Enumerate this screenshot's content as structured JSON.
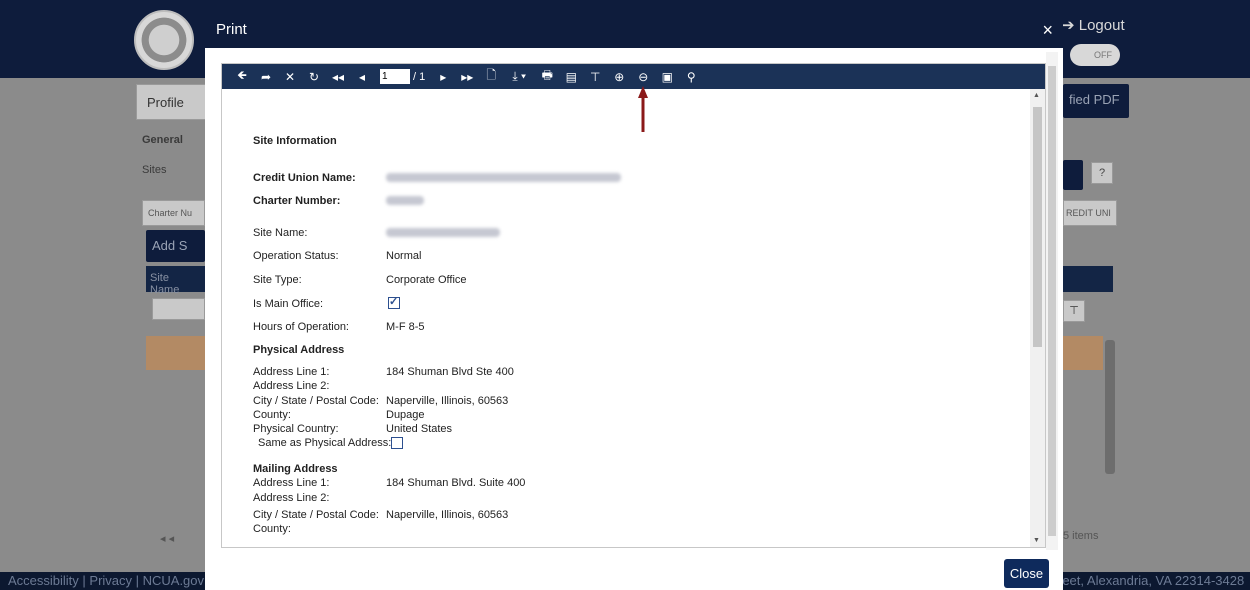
{
  "background": {
    "logout": "➔ Logout",
    "toggle": "OFF",
    "tab_profile": "Profile",
    "subtab_general": "General",
    "label_sites": "Sites",
    "filter_charter": "Charter Nu",
    "add_button": "Add S",
    "col_site_name": "Site Name",
    "verified_pdf": "fied PDF",
    "help": "?",
    "credit_uni": "REDIT UNI",
    "items": "5 items",
    "footer_left": "Accessibility | Privacy | NCUA.gov",
    "footer_right": "reet, Alexandria, VA 22314-3428"
  },
  "modal": {
    "title": "Print",
    "close_x": "×",
    "close_button": "Close"
  },
  "toolbar": {
    "page_current": "1",
    "page_total": "/ 1",
    "icons": [
      "undo-icon",
      "redo-icon",
      "stop-icon",
      "refresh-icon",
      "first-page-icon",
      "previous-page-icon",
      "next-page-icon",
      "last-page-icon",
      "page-setup-icon",
      "export-icon",
      "print-icon",
      "print-layout-icon",
      "parameters-icon",
      "zoom-in-icon",
      "zoom-out-icon",
      "full-screen-icon",
      "search-icon"
    ]
  },
  "report": {
    "section_title": "Site Information",
    "credit_union_label": "Credit Union Name:",
    "charter_number_label": "Charter Number:",
    "site_name_label": "Site Name:",
    "operation_status_label": "Operation Status:",
    "operation_status": "Normal",
    "site_type_label": "Site Type:",
    "site_type": "Corporate Office",
    "main_office_label": "Is Main Office:",
    "hours_label": "Hours of Operation:",
    "hours": "M-F 8-5",
    "physical_heading": "Physical Address",
    "phys_line1_label": "Address Line 1:",
    "phys_line1": "184 Shuman Blvd Ste 400",
    "phys_line2_label": "Address Line 2:",
    "phys_city_label": "City / State / Postal Code:",
    "phys_city": "Naperville, Illinois, 60563",
    "phys_county_label": "County:",
    "phys_county": "Dupage",
    "phys_country_label": "Physical Country:",
    "phys_country": "United States",
    "same_as_label": "Same as Physical Address:",
    "mailing_heading": "Mailing Address",
    "mail_line1_label": "Address Line 1:",
    "mail_line1": "184 Shuman Blvd. Suite 400",
    "mail_line2_label": "Address Line 2:",
    "mail_city_label": "City / State / Postal Code:",
    "mail_city": "Naperville, Illinois, 60563",
    "mail_county_label": "County:"
  },
  "colors": {
    "header_navy": "#0e1c3c",
    "toolbar_navy": "#1b3257",
    "annotation_arrow": "#8b1a1a"
  }
}
